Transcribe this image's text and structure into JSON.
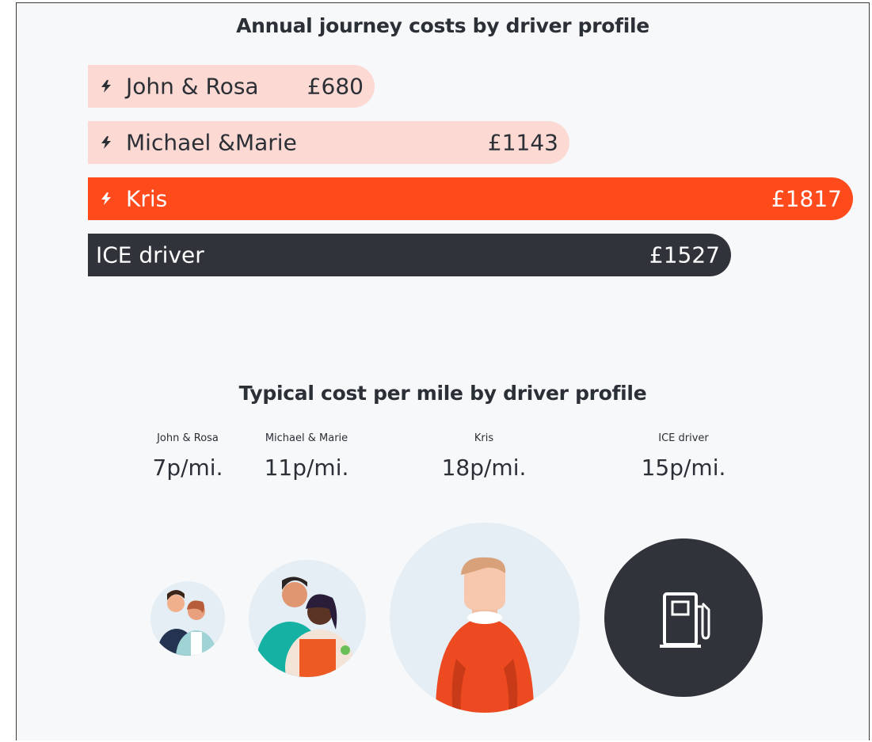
{
  "chart_data": [
    {
      "type": "bar",
      "orientation": "horizontal",
      "title": "Annual journey costs by driver profile",
      "categories": [
        "John & Rosa",
        "Michael &Marie",
        "Kris",
        "ICE driver"
      ],
      "values": [
        680,
        1143,
        1817,
        1527
      ],
      "value_labels": [
        "£680",
        "£1143",
        "£1817",
        "£1527"
      ],
      "unit": "£",
      "colors": [
        "#fcd9d3",
        "#fcd9d3",
        "#ff4a1c",
        "#30343a"
      ],
      "label_colors": [
        "#2b2f36",
        "#2b2f36",
        "#ffffff",
        "#ffffff"
      ],
      "electric_icon": [
        true,
        true,
        true,
        false
      ],
      "xlim": [
        0,
        1817
      ]
    },
    {
      "type": "table",
      "title": "Typical cost per mile by driver profile",
      "categories": [
        "John & Rosa",
        "Michael & Marie",
        "Kris",
        "ICE driver"
      ],
      "values": [
        7,
        11,
        18,
        15
      ],
      "value_labels": [
        "7p/mi.",
        "11p/mi.",
        "18p/mi.",
        "15p/mi."
      ],
      "unit": "p/mi."
    }
  ],
  "avatars": [
    {
      "name": "couple-avatar-small",
      "icon": "couple-illustration"
    },
    {
      "name": "couple-avatar-medium",
      "icon": "couple-illustration"
    },
    {
      "name": "kris-avatar",
      "icon": "person-illustration"
    },
    {
      "name": "ice-driver-avatar",
      "icon": "fuel-pump-icon"
    }
  ]
}
